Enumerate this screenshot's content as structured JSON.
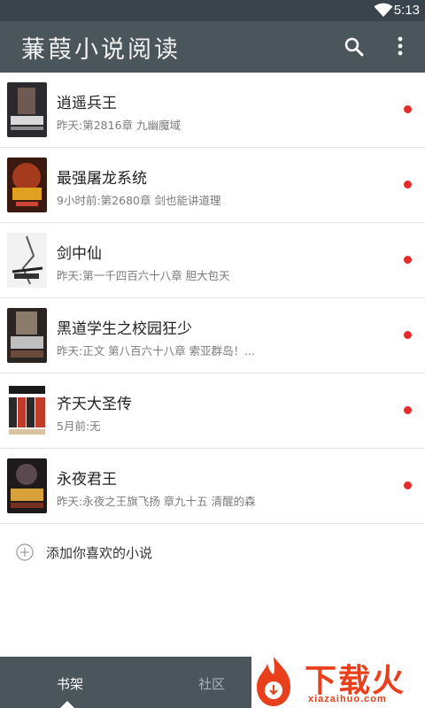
{
  "status": {
    "time": "5:13"
  },
  "appbar": {
    "title": "蒹葭小说阅读",
    "search_icon": "search-icon",
    "menu_icon": "more-vert-icon"
  },
  "books": [
    {
      "name": "逍遥兵王",
      "update": "昨天:第2816章 九幽魔域",
      "unread": true
    },
    {
      "name": "最强屠龙系统",
      "update": "9小时前:第2680章 剑也能讲道理",
      "unread": true
    },
    {
      "name": "剑中仙",
      "update": "昨天:第一千四百六十八章 胆大包天",
      "unread": true
    },
    {
      "name": "黑道学生之校园狂少",
      "update": "昨天:正文 第八百六十八章 索亚群岛！...",
      "unread": true
    },
    {
      "name": "齐天大圣传",
      "update": "5月前:无",
      "unread": true
    },
    {
      "name": "永夜君王",
      "update": "昨天:永夜之王旗飞扬 章九十五 清醒的森",
      "unread": true
    }
  ],
  "add_book": {
    "label": "添加你喜欢的小说"
  },
  "tabs": [
    {
      "label": "书架",
      "active": true
    },
    {
      "label": "社区",
      "active": false
    }
  ],
  "watermark": {
    "text": "下载火",
    "site": "xiazaihuo.com"
  },
  "colors": {
    "bar": "#4a555c",
    "status_bar": "#3a444c",
    "unread_dot": "#e52b2b",
    "watermark": "#e8401c"
  }
}
